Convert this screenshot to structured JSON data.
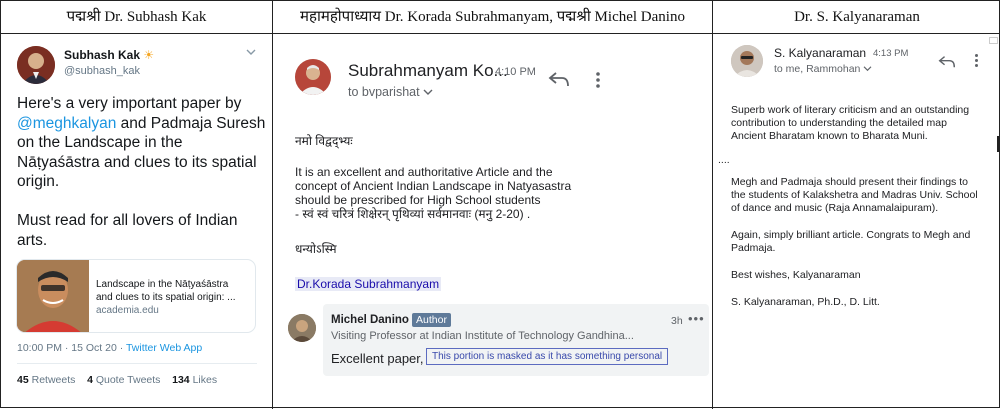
{
  "columns": [
    {
      "header": "पद्मश्री Dr. Subhash Kak"
    },
    {
      "header": "महामहोपाध्याय Dr. Korada Subrahmanyam, पद्मश्री Michel Danino"
    },
    {
      "header": "Dr. S. Kalyanaraman"
    }
  ],
  "tweet": {
    "name": "Subhash Kak",
    "name_emoji": "☀",
    "handle": "@subhash_kak",
    "text_part1": "Here's a very important paper by ",
    "mention": "@meghkalyan",
    "text_part2": " and Padmaja Suresh on the Landscape in the Nāṭyaśāstra and clues to its spatial origin.",
    "text_part3": "Must read for all lovers of Indian arts.",
    "card": {
      "title_line1": "Landscape in the Nāṭyaśāstra",
      "title_line2": "and clues to its spatial origin: ...",
      "domain": "academia.edu"
    },
    "timestamp": "10:00 PM · 15 Oct 20 · ",
    "source": "Twitter Web App",
    "retweets_count": "45",
    "retweets_label": "Retweets",
    "quotes_count": "4",
    "quotes_label": "Quote Tweets",
    "likes_count": "134",
    "likes_label": "Likes"
  },
  "email1": {
    "sender": "Subrahmanyam Ko...",
    "time": "4:10 PM",
    "to": "to bvparishat",
    "greeting": "नमो विद्वद्भ्यः",
    "body": [
      "It is an excellent and authoritative Article  and  the",
      "concept of Ancient Indian Landscape in Natyasastra",
      "should be prescribed for High School students",
      "- स्वं स्वं चरित्रं शिक्षेरन् पृथिव्यां सर्वमानवाः (मनु 2-20) ."
    ],
    "closing": "धन्योऽस्मि",
    "signature": "Dr.Korada Subrahmanyam",
    "comment": {
      "name": "Michel Danino",
      "badge": "Author",
      "time": "3h",
      "dots": "•••",
      "role": "Visiting Professor at Indian Institute of Technology Gandhina...",
      "text": "Excellent paper,",
      "masked_note": "This portion is masked as it has something personal"
    }
  },
  "email2": {
    "sender": "S. Kalyanaraman",
    "time": "4:13 PM",
    "to": "to me, Rammohan",
    "para1": [
      "Superb work of literary criticism and an outstanding",
      "contribution to understanding the detailed map",
      "Ancient Bharatam known to Bharata Muni."
    ],
    "ellipsis": "....",
    "para2": [
      "Megh and Padmaja should present their findings to",
      "the students of Kalakshetra and Madras Univ. School",
      "of dance and music (Raja Annamalaipuram)."
    ],
    "para3": [
      "Again, simply brilliant article. Congrats to Megh and",
      "Padmaja."
    ],
    "wishes": "Best wishes, Kalyanaraman",
    "signature": "S. Kalyanaraman, Ph.D., D. Litt."
  },
  "icons": {
    "tweet_menu": "chevron-down-icon",
    "reply": "reply-icon",
    "more": "more-vertical-icon",
    "to_expand": "chevron-down-icon"
  },
  "colors": {
    "twitter_blue": "#1b95e0",
    "link_blue": "#1a0dab",
    "masked_border": "#5c6bc0",
    "badge": "#5f7a99"
  }
}
